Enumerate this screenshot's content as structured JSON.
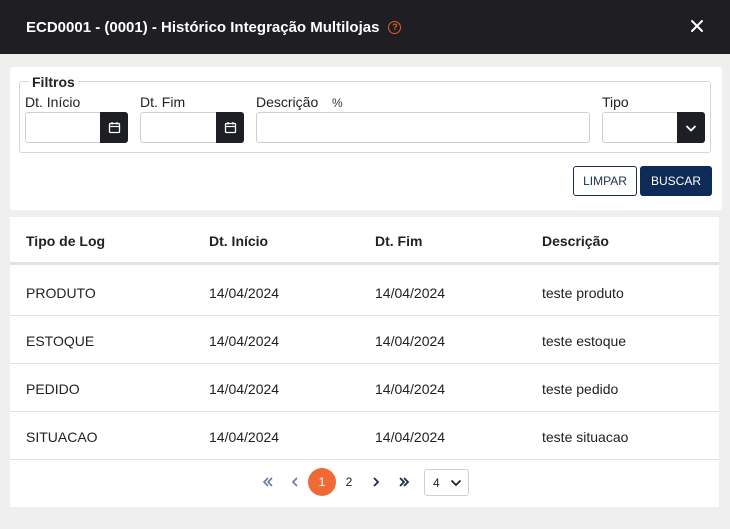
{
  "dialog": {
    "title": "ECD0001 - (0001) - Histórico Integração Multilojas",
    "help_icon": "question-circle-icon",
    "close_icon": "close-icon"
  },
  "filters": {
    "legend": "Filtros",
    "dt_inicio_label": "Dt. Início",
    "dt_inicio_value": "",
    "dt_fim_label": "Dt. Fim",
    "dt_fim_value": "",
    "descricao_label": "Descrição",
    "descricao_hint": "%",
    "descricao_value": "",
    "tipo_label": "Tipo",
    "tipo_value": "",
    "clear_label": "LIMPAR",
    "search_label": "BUSCAR"
  },
  "table": {
    "columns": [
      "Tipo de Log",
      "Dt. Início",
      "Dt. Fim",
      "Descrição"
    ],
    "rows": [
      [
        "PRODUTO",
        "14/04/2024",
        "14/04/2024",
        "teste produto"
      ],
      [
        "ESTOQUE",
        "14/04/2024",
        "14/04/2024",
        "teste estoque"
      ],
      [
        "PEDIDO",
        "14/04/2024",
        "14/04/2024",
        "teste pedido"
      ],
      [
        "SITUACAO",
        "14/04/2024",
        "14/04/2024",
        "teste situacao"
      ]
    ]
  },
  "pagination": {
    "first_icon": "double-chevron-left-icon",
    "prev_icon": "chevron-left-icon",
    "pages": [
      "1",
      "2"
    ],
    "current_page": "1",
    "next_icon": "chevron-right-icon",
    "last_icon": "double-chevron-right-icon",
    "page_size": "4"
  },
  "colors": {
    "header_bg": "#1f1f23",
    "accent": "#f06a35",
    "primary_button": "#0e2a56"
  }
}
